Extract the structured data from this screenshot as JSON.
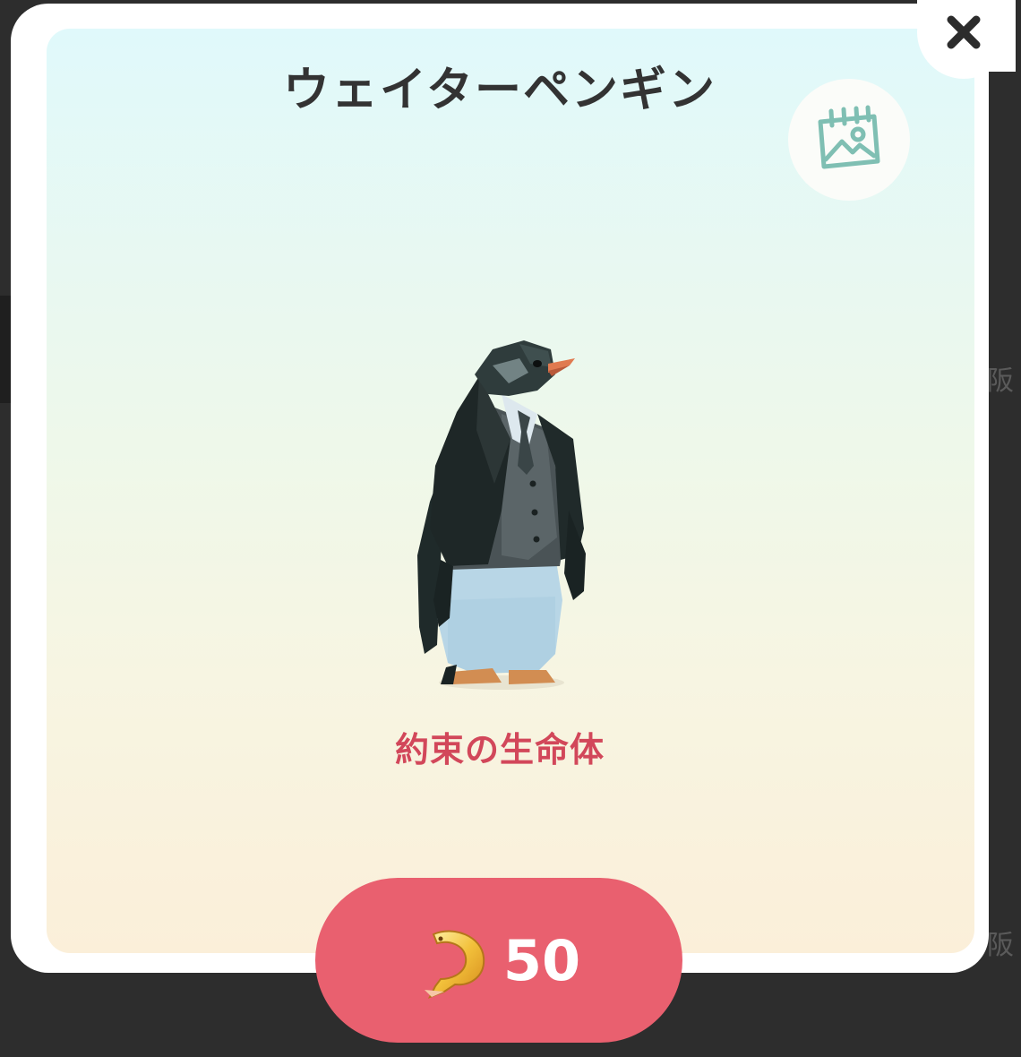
{
  "character": {
    "name": "ウェイターペンギン",
    "description": "約束の生命体"
  },
  "purchase": {
    "price": "50",
    "currency_icon": "golden-fish-icon"
  },
  "buttons": {
    "close_icon": "close-icon",
    "album_icon": "photo-calendar-icon"
  },
  "background_text": {
    "right_top": "阪",
    "right_bottom": "阪"
  },
  "colors": {
    "price_button": "#e9606f",
    "subtitle": "#d2475a",
    "title": "#333333",
    "album_icon": "#7fbfb3"
  }
}
